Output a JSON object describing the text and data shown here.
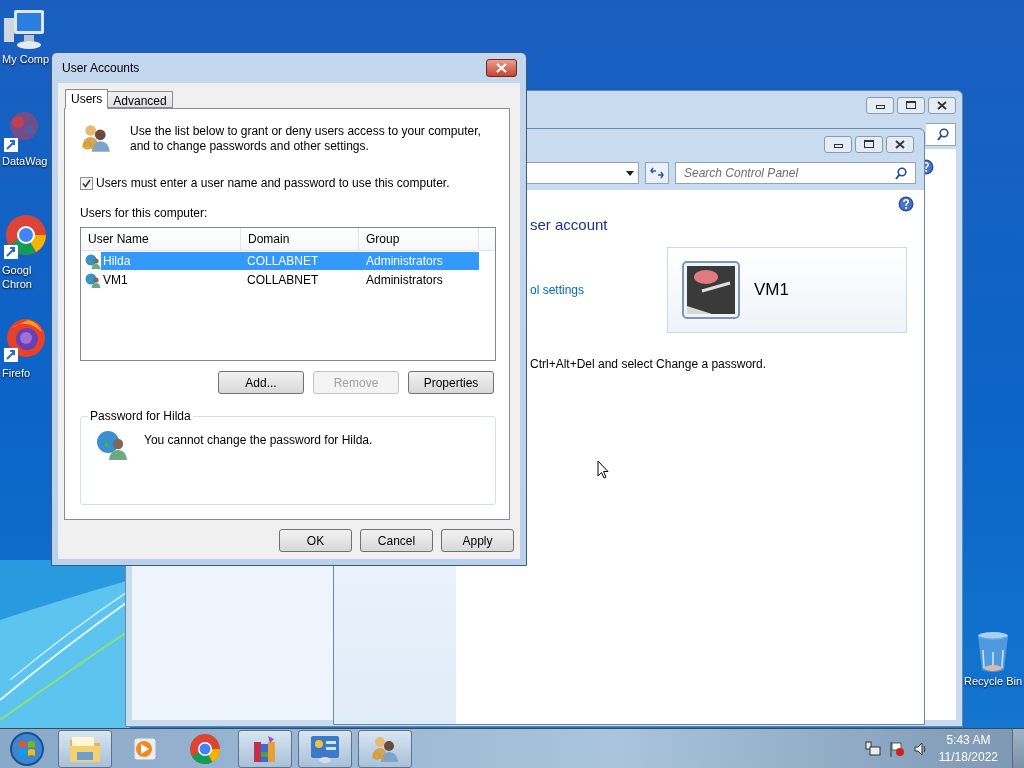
{
  "desktop": {
    "icons": [
      {
        "label": "My Comp",
        "kind": "computer"
      },
      {
        "label": "DataWag",
        "kind": "datawag"
      },
      {
        "label": "Googl\nChron",
        "kind": "chrome"
      },
      {
        "label": "Firefo",
        "kind": "firefox"
      },
      {
        "label": "Recycle Bin",
        "kind": "recycle"
      }
    ]
  },
  "control_panel": {
    "search": {
      "placeholder": "Search Control Panel"
    },
    "heading": "ser account",
    "link": "ol settings",
    "instruction": "Ctrl+Alt+Del and select Change a password.",
    "user_tile": {
      "name": "VM1"
    }
  },
  "dialog": {
    "title": "User Accounts",
    "tabs": [
      {
        "label": "Users",
        "selected": true
      },
      {
        "label": "Advanced",
        "selected": false
      }
    ],
    "intro": "Use the list below to grant or deny users access to your computer, and to change passwords and other settings.",
    "require_login": {
      "label": "Users must enter a user name and password to use this computer.",
      "checked": true
    },
    "users_label": "Users for this computer:",
    "table": {
      "columns": [
        "User Name",
        "Domain",
        "Group"
      ],
      "rows": [
        {
          "cells": [
            "Hilda",
            "COLLABNET",
            "Administrators"
          ],
          "selected": true
        },
        {
          "cells": [
            "VM1",
            "COLLABNET",
            "Administrators"
          ],
          "selected": false
        }
      ]
    },
    "buttons": [
      {
        "label": "Add...",
        "disabled": false
      },
      {
        "label": "Remove",
        "disabled": true
      },
      {
        "label": "Properties",
        "disabled": false
      }
    ],
    "password_group": {
      "title": "Password for Hilda",
      "message": "You cannot change the password for Hilda."
    },
    "footer_buttons": [
      "OK",
      "Cancel",
      "Apply"
    ]
  },
  "taskbar": {
    "apps": [
      {
        "kind": "explorer",
        "running": true
      },
      {
        "kind": "media",
        "running": false
      },
      {
        "kind": "chrome",
        "running": false
      },
      {
        "kind": "archive",
        "running": true
      },
      {
        "kind": "control",
        "running": true
      },
      {
        "kind": "users",
        "running": true
      }
    ],
    "clock": {
      "time": "5:43 AM",
      "date": "11/18/2022"
    }
  }
}
